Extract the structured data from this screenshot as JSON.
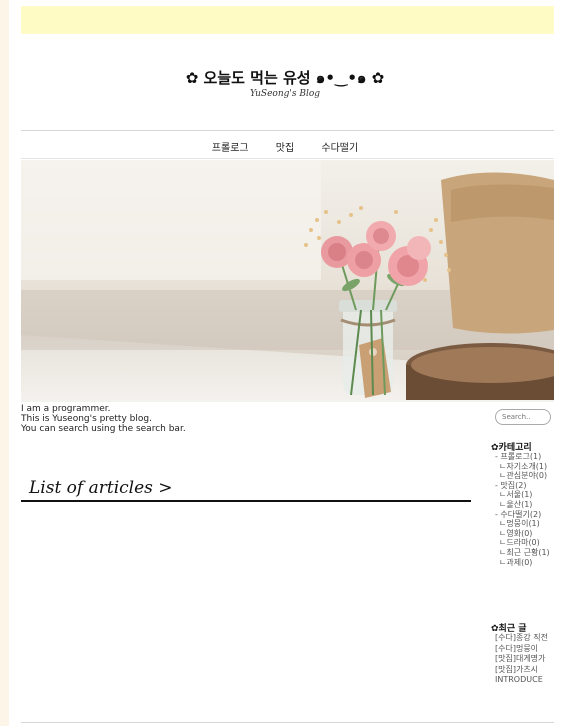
{
  "header": {
    "title": "✿ 오늘도 먹는 유성 ๑•‿•๑ ✿",
    "subtitle": "YuSeong's Blog"
  },
  "nav": {
    "items": [
      "프롤로그",
      "맛집",
      "수다떨기"
    ]
  },
  "intro": {
    "lines": [
      "I am a programmer.",
      "This is Yuseong's pretty blog.",
      "You can search using the search bar."
    ]
  },
  "main": {
    "list_title": "List of articles >"
  },
  "sidebar": {
    "search_placeholder": "Search..",
    "category_heading": "✿카테고리",
    "categories": [
      {
        "label": "- 프롤로그(1)",
        "level": "top"
      },
      {
        "label": "ㄴ자기소개(1)",
        "level": "sub"
      },
      {
        "label": "ㄴ관심분야(0)",
        "level": "sub"
      },
      {
        "label": "- 맛집(2)",
        "level": "top"
      },
      {
        "label": "ㄴ서울(1)",
        "level": "sub"
      },
      {
        "label": "ㄴ울산(1)",
        "level": "sub"
      },
      {
        "label": "- 수다떨기(2)",
        "level": "top"
      },
      {
        "label": "ㄴ멍뭉이(1)",
        "level": "sub"
      },
      {
        "label": "ㄴ영화(0)",
        "level": "sub"
      },
      {
        "label": "ㄴ드라마(0)",
        "level": "sub"
      },
      {
        "label": "ㄴ최근 근황(1)",
        "level": "sub"
      },
      {
        "label": "ㄴ과제(0)",
        "level": "sub"
      }
    ],
    "recent_heading": "✿최근 글",
    "recent_posts": [
      "[수다]종강 직전",
      "[수다]멍뭉이",
      "[맛집]대게명가",
      "[맛집]가츠시",
      "INTRODUCE"
    ]
  }
}
